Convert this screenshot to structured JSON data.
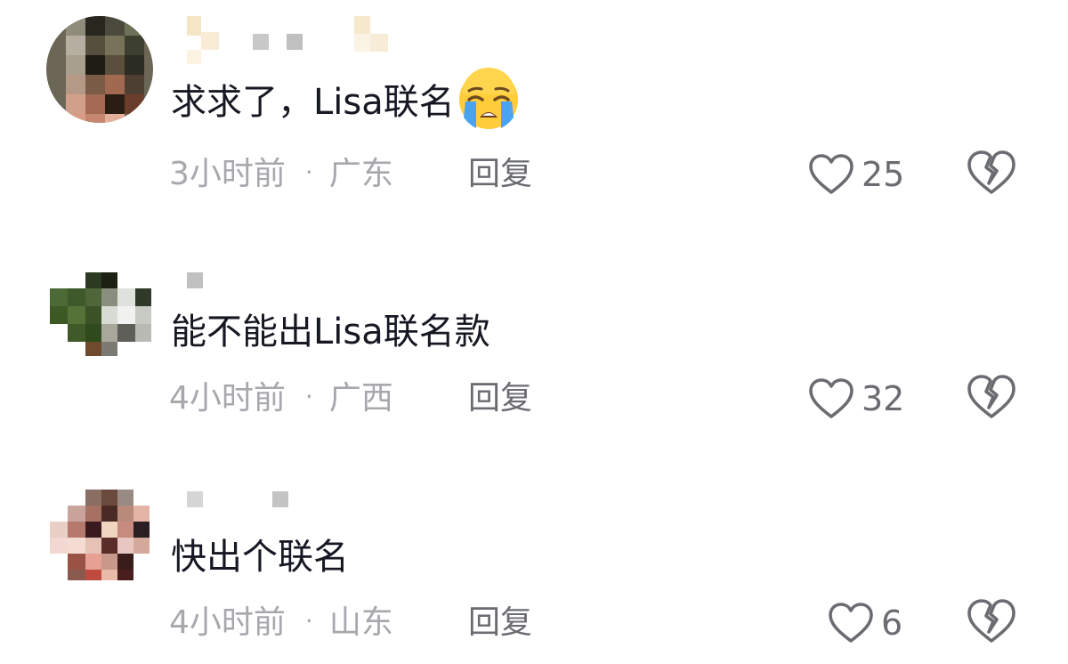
{
  "comments": [
    {
      "text": "求求了，Lisa联名",
      "emoji": "loudly-crying-face",
      "time": "3小时前",
      "separator": "·",
      "location": "广东",
      "reply_label": "回复",
      "likes": "25"
    },
    {
      "text": "能不能出Lisa联名款",
      "time": "4小时前",
      "separator": "·",
      "location": "广西",
      "reply_label": "回复",
      "likes": "32"
    },
    {
      "text": "快出个联名",
      "time": "4小时前",
      "separator": "·",
      "location": "山东",
      "reply_label": "回复",
      "likes": "6"
    }
  ],
  "icons": {
    "like": "heart-outline-icon",
    "dislike": "broken-heart-icon"
  },
  "colors": {
    "text": "#161823",
    "meta": "#a7a8ae",
    "reply": "#6b6c72",
    "icon": "#6b6c72",
    "background": "#ffffff"
  }
}
